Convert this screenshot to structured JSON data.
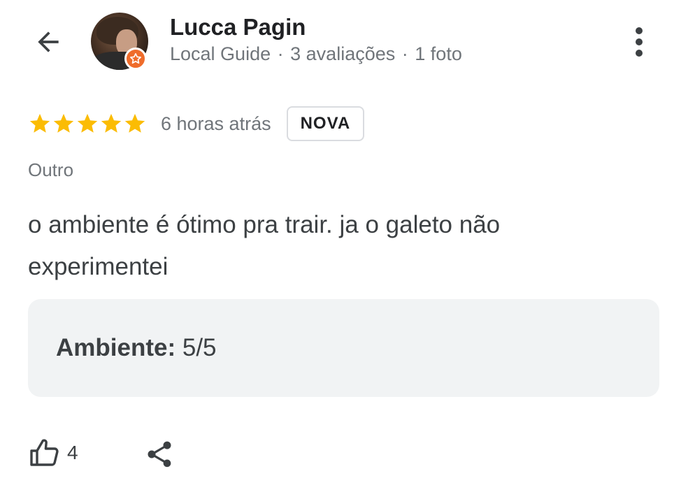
{
  "header": {
    "back_icon": "arrow-left-icon",
    "user_name": "Lucca Pagin",
    "user_role": "Local Guide",
    "review_count": "3 avaliações",
    "photo_count": "1 foto",
    "separator": "·",
    "badge_icon": "local-guide-star-icon",
    "badge_color": "#ef6c2b",
    "more_icon": "more-vertical-icon"
  },
  "review": {
    "rating": 5,
    "rating_max": 5,
    "star_color": "#fbbc04",
    "time_ago": "6 horas atrás",
    "new_badge": "NOVA",
    "category": "Outro",
    "text": "o ambiente é ótimo pra trair. ja o galeto não experimentei",
    "attributes": [
      {
        "label": "Ambiente:",
        "value": "5/5"
      }
    ]
  },
  "actions": {
    "like_icon": "thumbs-up-icon",
    "like_count": "4",
    "share_icon": "share-icon"
  }
}
